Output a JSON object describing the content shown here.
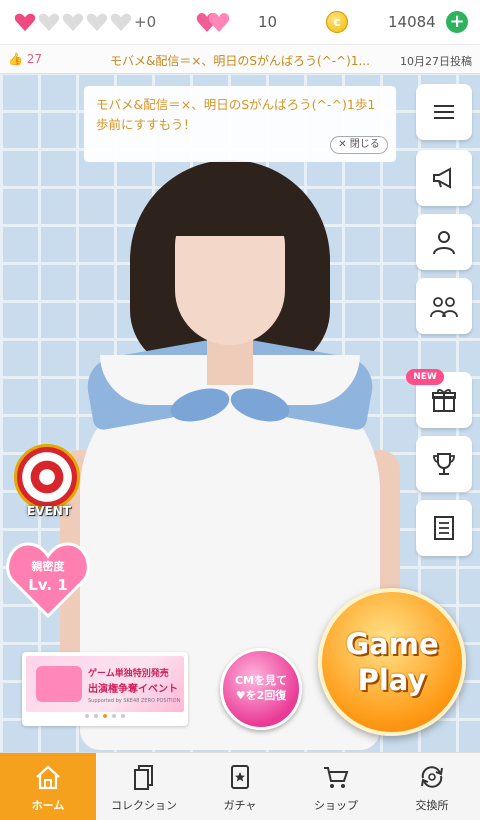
{
  "status": {
    "hearts_filled": 1,
    "hearts_total": 5,
    "hearts_bonus": "+0",
    "gems": "10",
    "coins": "14084",
    "coin_glyph": "c",
    "add_coin_glyph": "+"
  },
  "ticker": {
    "likes": "27",
    "message": "モバメ&配信＝×、明日のSがんばろう(^-^)1...",
    "date": "10月27日投稿"
  },
  "bubble": {
    "message": "モバメ&配信＝×、明日のSがんばろう(^-^)1歩1歩前にすすもう！",
    "close_label": "閉じる"
  },
  "side_menu": {
    "items": [
      {
        "name": "menu",
        "icon": "hamburger-icon"
      },
      {
        "name": "announcements",
        "icon": "megaphone-icon"
      },
      {
        "name": "profile",
        "icon": "person-icon"
      },
      {
        "name": "friends",
        "icon": "people-icon"
      },
      {
        "name": "gifts",
        "icon": "gift-icon",
        "badge": "NEW"
      },
      {
        "name": "ranking",
        "icon": "trophy-icon"
      },
      {
        "name": "notes",
        "icon": "list-icon"
      }
    ],
    "new_badge": "NEW"
  },
  "event": {
    "label": "EVENT"
  },
  "affinity": {
    "title": "親密度",
    "level": "Lv. 1"
  },
  "banner": {
    "line1": "ゲーム単独特別発売",
    "line2": "出演権争奪イベント",
    "line3": "Supported by SKE48 ZERO POSITION",
    "slides": 5,
    "active_slide": 3
  },
  "cm_button": {
    "line1": "CMを見て",
    "line2": "♥を2回復"
  },
  "gameplay": {
    "line1": "Game",
    "line2": "Play"
  },
  "bottom_nav": [
    {
      "label": "ホーム",
      "icon": "home-icon",
      "active": true
    },
    {
      "label": "コレクション",
      "icon": "collection-icon",
      "active": false
    },
    {
      "label": "ガチャ",
      "icon": "gacha-icon",
      "active": false
    },
    {
      "label": "ショップ",
      "icon": "cart-icon",
      "active": false
    },
    {
      "label": "交換所",
      "icon": "exchange-icon",
      "active": false
    }
  ],
  "colors": {
    "heart_pink": "#f0497e",
    "accent_orange": "#f6a11d",
    "ticker_text": "#c58a1c",
    "coin_green": "#2db35d"
  }
}
